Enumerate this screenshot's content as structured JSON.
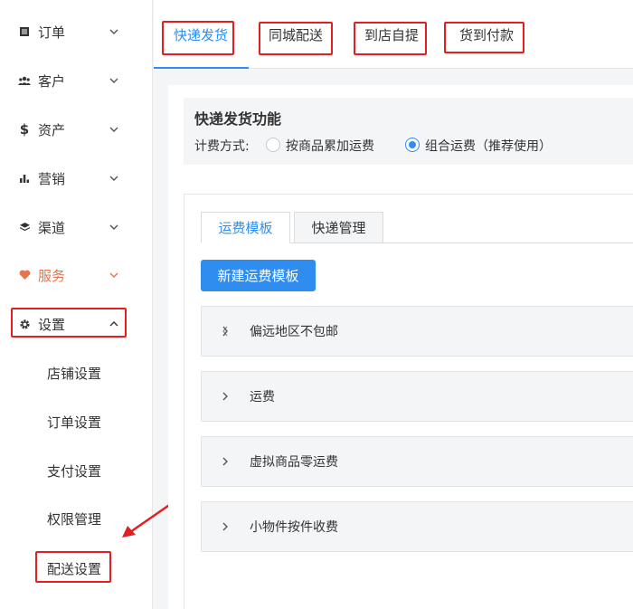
{
  "sidebar": {
    "items": [
      {
        "label": "订单",
        "icon": "list-icon"
      },
      {
        "label": "客户",
        "icon": "users-icon"
      },
      {
        "label": "资产",
        "icon": "dollar-icon"
      },
      {
        "label": "营销",
        "icon": "bar-chart-icon"
      },
      {
        "label": "渠道",
        "icon": "layers-icon"
      },
      {
        "label": "服务",
        "icon": "heart-icon",
        "active": true
      },
      {
        "label": "设置",
        "icon": "gear-icon",
        "expanded": true
      }
    ],
    "sub_items": [
      "店铺设置",
      "订单设置",
      "支付设置",
      "权限管理",
      "配送设置"
    ]
  },
  "top_tabs": [
    "快递发货",
    "同城配送",
    "到店自提",
    "货到付款"
  ],
  "active_top_tab": "快递发货",
  "feature": {
    "title": "快递发货功能",
    "fee_label": "计费方式:",
    "options": [
      "按商品累加运费",
      "组合运费（推荐使用）"
    ],
    "selected_option": "组合运费（推荐使用）"
  },
  "inner_tabs": [
    "运费模板",
    "快递管理"
  ],
  "active_inner_tab": "运费模板",
  "new_template_button": "新建运费模板",
  "templates": [
    "偏远地区不包邮",
    "运费",
    "虚拟商品零运费",
    "小物件按件收费"
  ],
  "colors": {
    "accent": "#2f8df0",
    "active_nav": "#e8734a",
    "annotation": "#e02020"
  }
}
